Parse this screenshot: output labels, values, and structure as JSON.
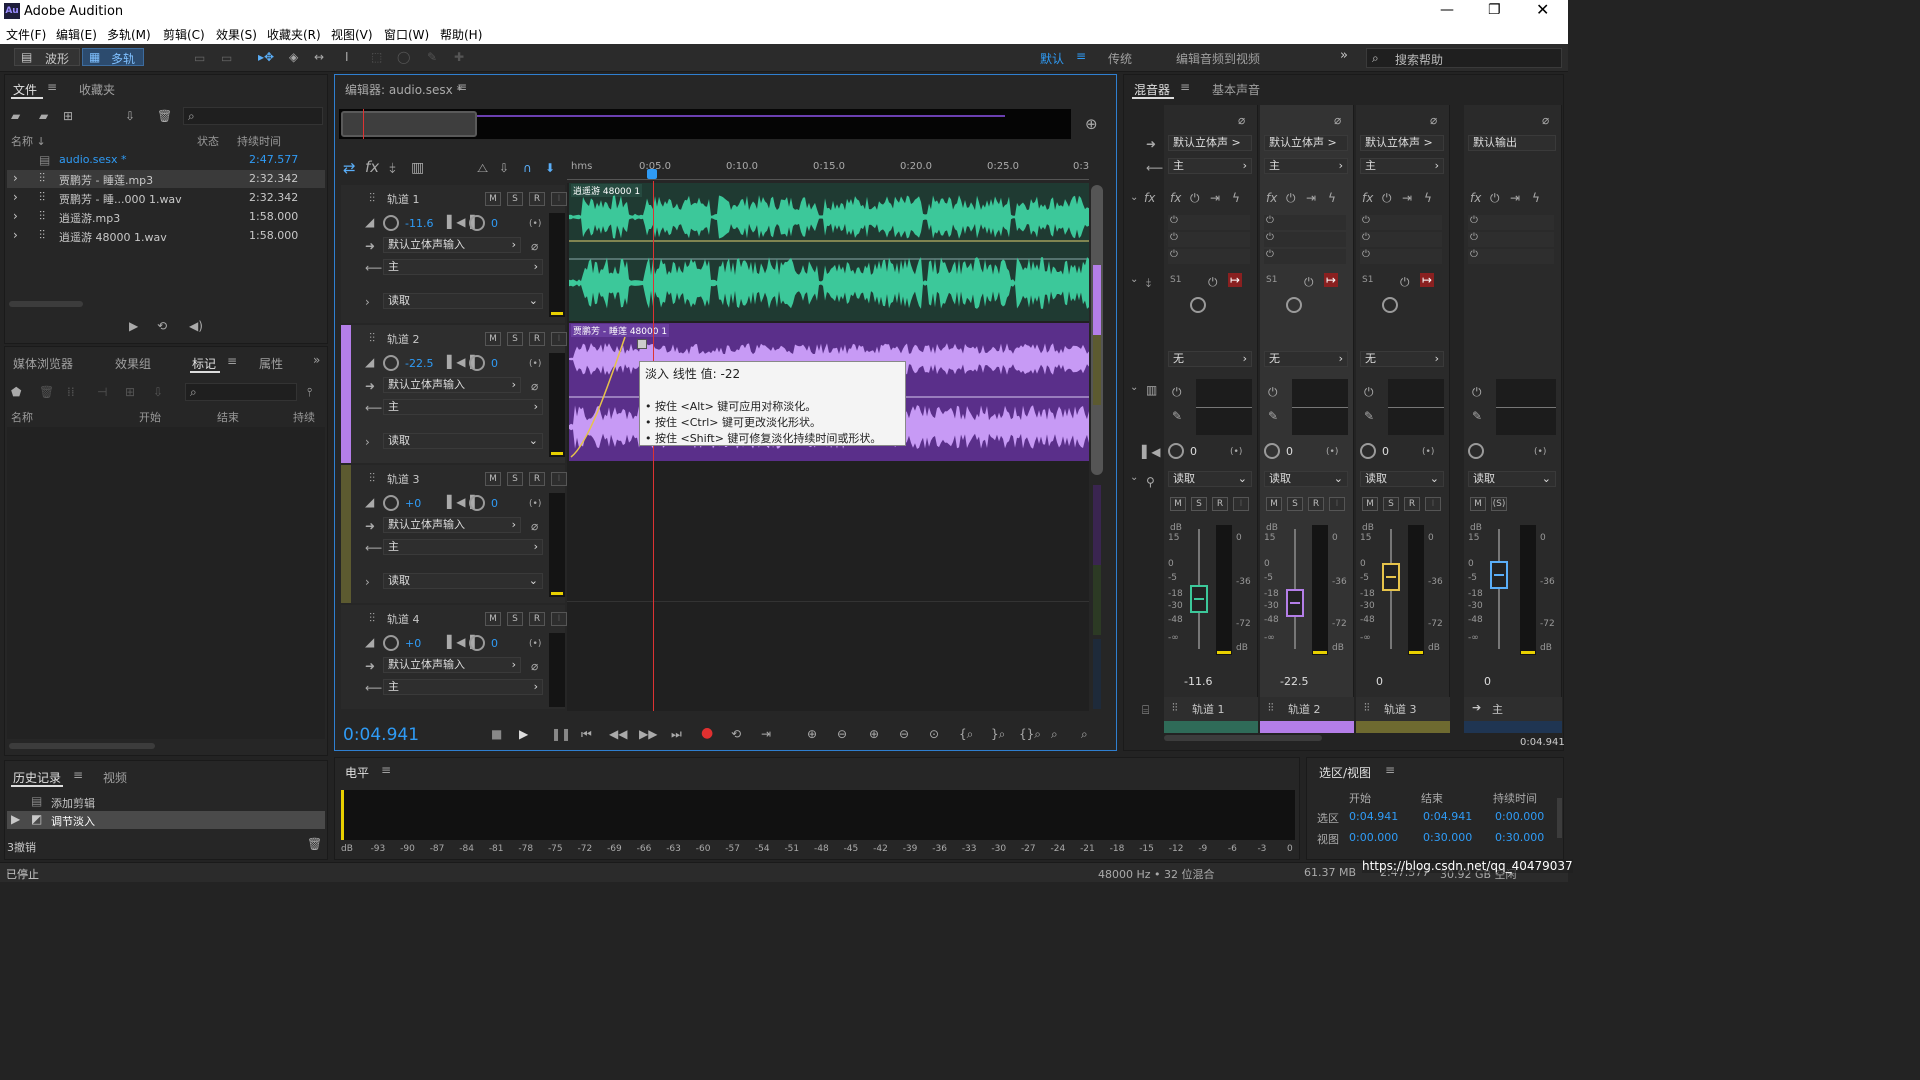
{
  "app": {
    "title": "Adobe Audition",
    "logo": "Au"
  },
  "menu": [
    "文件(F)",
    "编辑(E)",
    "多轨(M)",
    "剪辑(C)",
    "效果(S)",
    "收藏夹(R)",
    "视图(V)",
    "窗口(W)",
    "帮助(H)"
  ],
  "toolbar": {
    "waveform": "波形",
    "multitrack": "多轨",
    "workspaces": [
      "默认",
      "传统",
      "编辑音频到视频"
    ],
    "search_placeholder": "搜索帮助"
  },
  "files": {
    "tabs": [
      "文件",
      "收藏夹"
    ],
    "columns": [
      "名称 ↓",
      "状态",
      "持续时间"
    ],
    "items": [
      {
        "name": "audio.sesx *",
        "dur": "2:47.577"
      },
      {
        "name": "贾鹏芳 - 睡莲.mp3",
        "dur": "2:32.342"
      },
      {
        "name": "贾鹏芳 - 睡...000 1.wav",
        "dur": "2:32.342"
      },
      {
        "name": "逍遥游.mp3",
        "dur": "1:58.000"
      },
      {
        "name": "逍遥游 48000 1.wav",
        "dur": "1:58.000"
      }
    ]
  },
  "markers": {
    "tabs": [
      "媒体浏览器",
      "效果组",
      "标记",
      "属性"
    ],
    "columns": [
      "名称",
      "开始",
      "结束",
      "持续"
    ]
  },
  "history": {
    "tabs": [
      "历史记录",
      "视频"
    ],
    "items": [
      "添加剪辑",
      "调节淡入"
    ],
    "undo": "3撤销"
  },
  "status": {
    "left": "已停止",
    "sample": "48000 Hz • 32 位混合",
    "size": "61.37 MB",
    "dur": "2:47.577",
    "free": "30.92 GB 空闲"
  },
  "editor": {
    "title": "编辑器: audio.sesx *",
    "time": "0:04.941",
    "ruler": [
      "hms",
      "0:05.0",
      "0:10.0",
      "0:15.0",
      "0:20.0",
      "0:25.0",
      "0:3"
    ],
    "tracks": [
      {
        "name": "轨道 1",
        "vol": "-11.6",
        "pan": "0",
        "input": "默认立体声输入",
        "output": "主",
        "mode": "读取",
        "clip": "逍遥游 48000 1"
      },
      {
        "name": "轨道 2",
        "vol": "-22.5",
        "pan": "0",
        "input": "默认立体声输入",
        "output": "主",
        "mode": "读取",
        "clip": "贾鹏芳 - 睡莲 48000 1"
      },
      {
        "name": "轨道 3",
        "vol": "+0",
        "pan": "0",
        "input": "默认立体声输入",
        "output": "主",
        "mode": "读取"
      },
      {
        "name": "轨道 4",
        "vol": "+0",
        "pan": "0",
        "input": "默认立体声输入",
        "output": "主"
      }
    ]
  },
  "msr": [
    "M",
    "S",
    "R",
    "I"
  ],
  "tooltip": {
    "line1": "淡入 线性 值: -22",
    "line2": "• 按住 <Alt> 键可应用对称淡化。",
    "line3": "• 按住 <Ctrl> 键可更改淡化形状。",
    "line4": "• 按住 <Shift> 键可修复淡化持续时间或形状。"
  },
  "mixer": {
    "tabs": [
      "混音器",
      "基本声音"
    ],
    "channels": [
      {
        "in": "默认立体声 >",
        "out": "主",
        "send": "S1",
        "none": "无",
        "mode": "读取",
        "vol": "-11.6",
        "name": "轨道 1",
        "pan": "0"
      },
      {
        "in": "默认立体声 >",
        "out": "主",
        "send": "S1",
        "none": "无",
        "mode": "读取",
        "vol": "-22.5",
        "name": "轨道 2",
        "pan": "0"
      },
      {
        "in": "默认立体声 >",
        "out": "主",
        "send": "S1",
        "none": "无",
        "mode": "读取",
        "vol": "0",
        "name": "轨道 3",
        "pan": "0"
      },
      {
        "in": "默认输出",
        "mode": "读取",
        "vol": "0",
        "name": "主"
      }
    ],
    "db_scale": [
      "dB",
      "15",
      "0",
      "-5",
      "-18",
      "-30",
      "-48",
      "-∞"
    ],
    "right_scale": [
      "0",
      "-36",
      "-72",
      "dB"
    ],
    "time": "0:04.941"
  },
  "levels": {
    "title": "电平",
    "scale": [
      "dB",
      "-93",
      "-90",
      "-87",
      "-84",
      "-81",
      "-78",
      "-75",
      "-72",
      "-69",
      "-66",
      "-63",
      "-60",
      "-57",
      "-54",
      "-51",
      "-48",
      "-45",
      "-42",
      "-39",
      "-36",
      "-33",
      "-30",
      "-27",
      "-24",
      "-21",
      "-18",
      "-15",
      "-12",
      "-9",
      "-6",
      "-3",
      "0"
    ]
  },
  "selview": {
    "title": "选区/视图",
    "cols": [
      "开始",
      "结束",
      "持续时间"
    ],
    "sel_label": "选区",
    "view_label": "视图",
    "sel": [
      "0:04.941",
      "0:04.941",
      "0:00.000"
    ],
    "view": [
      "0:00.000",
      "0:30.000",
      "0:30.000"
    ]
  },
  "watermark": "https://blog.csdn.net/qq_40479037",
  "colors": {
    "accent": "#2f9bf5",
    "track1": "#3a9a7a",
    "track2": "#b47ee8",
    "track3": "#8c8640"
  }
}
